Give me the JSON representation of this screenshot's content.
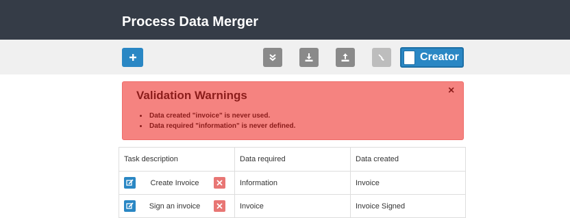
{
  "app": {
    "title": "Process Data Merger"
  },
  "toolbar": {
    "add_icon": "plus-icon",
    "validate_icon": "double-check-icon",
    "download_icon": "download-icon",
    "upload_icon": "upload-icon",
    "clear_icon": "broom-icon",
    "creator_label": "Creator"
  },
  "alert": {
    "title": "Validation Warnings",
    "close_label": "×",
    "items": [
      "Data created \"invoice\" is never used.",
      "Data required \"information\" is never defined."
    ]
  },
  "table": {
    "headers": [
      "Task description",
      "Data required",
      "Data created"
    ],
    "rows": [
      {
        "task": "Create Invoice",
        "required": "Information",
        "created": "Invoice"
      },
      {
        "task": "Sign an invoice",
        "required": "Invoice",
        "created": "Invoice Signed"
      }
    ]
  },
  "colors": {
    "header_bg": "#353c47",
    "primary": "#2a87c4",
    "alert_bg": "#f58380",
    "alert_text": "#8b1c1a",
    "delete": "#e87674"
  }
}
